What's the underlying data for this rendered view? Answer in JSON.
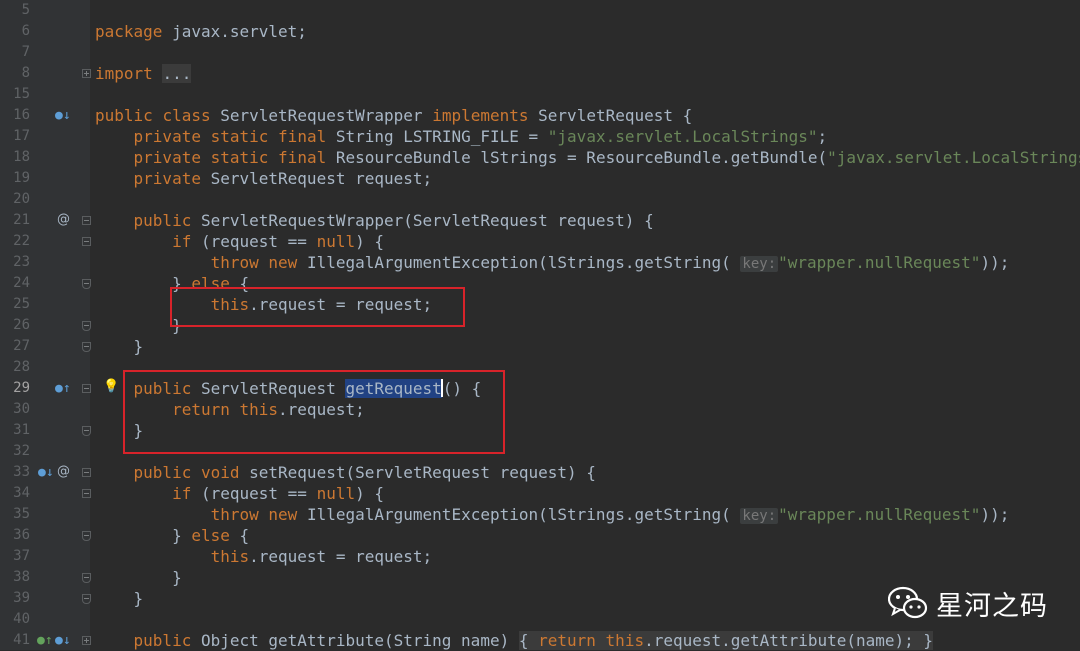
{
  "lines": [
    {
      "num": "5",
      "text": ""
    },
    {
      "num": "6",
      "text": "package javax.servlet;"
    },
    {
      "num": "7",
      "text": ""
    },
    {
      "num": "8",
      "text": "import ..."
    },
    {
      "num": "15",
      "text": ""
    },
    {
      "num": "16",
      "text": "public class ServletRequestWrapper implements ServletRequest {"
    },
    {
      "num": "17",
      "text": "    private static final String LSTRING_FILE = \"javax.servlet.LocalStrings\";"
    },
    {
      "num": "18",
      "text": "    private static final ResourceBundle lStrings = ResourceBundle.getBundle(\"javax.servlet.LocalStrings"
    },
    {
      "num": "19",
      "text": "    private ServletRequest request;"
    },
    {
      "num": "20",
      "text": ""
    },
    {
      "num": "21",
      "text": "    public ServletRequestWrapper(ServletRequest request) {"
    },
    {
      "num": "22",
      "text": "        if (request == null) {"
    },
    {
      "num": "23",
      "text": "            throw new IllegalArgumentException(lStrings.getString( key: \"wrapper.nullRequest\"));"
    },
    {
      "num": "24",
      "text": "        } else {"
    },
    {
      "num": "25",
      "text": "            this.request = request;"
    },
    {
      "num": "26",
      "text": "        }"
    },
    {
      "num": "27",
      "text": "    }"
    },
    {
      "num": "28",
      "text": ""
    },
    {
      "num": "29",
      "text": "    public ServletRequest getRequest() {"
    },
    {
      "num": "30",
      "text": "        return this.request;"
    },
    {
      "num": "31",
      "text": "    }"
    },
    {
      "num": "32",
      "text": ""
    },
    {
      "num": "33",
      "text": "    public void setRequest(ServletRequest request) {"
    },
    {
      "num": "34",
      "text": "        if (request == null) {"
    },
    {
      "num": "35",
      "text": "            throw new IllegalArgumentException(lStrings.getString( key: \"wrapper.nullRequest\"));"
    },
    {
      "num": "36",
      "text": "        } else {"
    },
    {
      "num": "37",
      "text": "            this.request = request;"
    },
    {
      "num": "38",
      "text": "        }"
    },
    {
      "num": "39",
      "text": "    }"
    },
    {
      "num": "40",
      "text": ""
    },
    {
      "num": "41",
      "text": "    public Object getAttribute(String name) { return this.request.getAttribute(name); }"
    }
  ],
  "code": {
    "kw_package": "package",
    "pkg_name": " javax.servlet;",
    "kw_import": "import",
    "import_dots": "...",
    "kw_public": "public",
    "kw_class": "class",
    "kw_implements": "implements",
    "kw_private": "private",
    "kw_static": "static",
    "kw_final": "final",
    "kw_if": "if",
    "kw_null": "null",
    "kw_throw": "throw",
    "kw_new": "new",
    "kw_else": "else",
    "kw_this": "this",
    "kw_return": "return",
    "kw_void": "void",
    "cls_wrapper": "ServletRequestWrapper",
    "iface": "ServletRequest",
    "str_localstrings": "\"javax.servlet.LocalStrings\"",
    "str_localstrings_trunc": "\"javax.servlet.LocalStrings",
    "hint_key": "key:",
    "str_nullrequest": "\"wrapper.nullRequest\"",
    "method_getrequest": "getRequest"
  },
  "watermark": {
    "text": "星河之码"
  }
}
